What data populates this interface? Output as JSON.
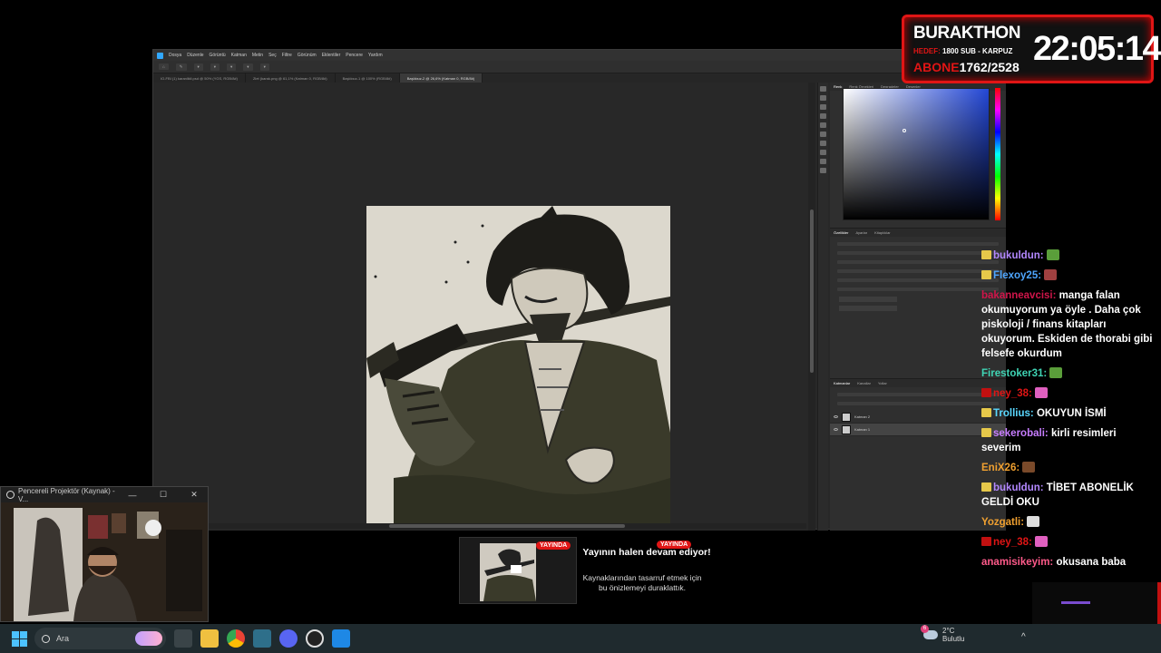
{
  "photoshop": {
    "menu": [
      "Dosya",
      "Düzenle",
      "Görüntü",
      "Katman",
      "Metin",
      "Seç",
      "Filtre",
      "Görünüm",
      "Eklentiler",
      "Pencere",
      "Yardım"
    ],
    "tabs": [
      "IO-FBI (1) karanlikli.psd @ 50% (YGS, RGB/8#)",
      "Ziet (karak.png @ 61,1% (Katman 0, RGB/8#)",
      "Başlıksız-1 @ 100% (RGB/8#)",
      "Başlıksız-2 @ 26,6% (Katman 0, RGB/8#)"
    ],
    "panel_tabs_top": [
      "Renk",
      "Renk Örnekleri",
      "Degradeler",
      "Desenler"
    ],
    "panel_tabs_mid": [
      "Özellikler",
      "Ayarlar",
      "Kitaplıklar"
    ],
    "panel_tabs_layers": [
      "Katmanlar",
      "Kanallar",
      "Yollar"
    ],
    "layers": [
      "Katman 2",
      "Katman 1"
    ]
  },
  "timer": {
    "brand": "BURAKTHON",
    "hedef_label": "HEDEF:",
    "hedef_value": "1800 SUB - KARPUZ",
    "abone_label": "ABONE",
    "abone_value": "1762/2528",
    "time": "22:05:14"
  },
  "chat": [
    {
      "user": "bukuldun:",
      "color": "#b388ff",
      "text": "",
      "badge": "#e6c84a",
      "emote": "#5a9e3a"
    },
    {
      "user": "Flexoy25:",
      "color": "#4ea6ff",
      "text": "",
      "badge": "#e6c84a",
      "emote": "#a04040"
    },
    {
      "user": "bakanneavcisi:",
      "color": "#d0154a",
      "text": "manga falan okumuyorum ya öyle . Daha çok piskoloji / finans kitapları okuyorum. Eskiden de thorabi gibi felsefe okurdum",
      "badge": "",
      "emote": ""
    },
    {
      "user": "Firestoker31:",
      "color": "#3fd4b4",
      "text": "",
      "badge": "",
      "emote": "#5a9e3a"
    },
    {
      "user": "ney_38:",
      "color": "#e01515",
      "text": "",
      "badge": "#c21010",
      "emote": "#e060c0"
    },
    {
      "user": "Trollius:",
      "color": "#5ad8ff",
      "text": "OKUYUN İSMİ",
      "badge": "#e6c84a",
      "emote": ""
    },
    {
      "user": "sekerobali:",
      "color": "#c77dff",
      "text": "kirli resimleri severim",
      "badge": "#e6c84a",
      "emote": ""
    },
    {
      "user": "EniX26:",
      "color": "#f0a030",
      "text": "",
      "badge": "",
      "emote": "#7a4a2a"
    },
    {
      "user": "bukuldun:",
      "color": "#b388ff",
      "text": "TİBET ABONELİK GELDİ OKU",
      "badge": "#e6c84a",
      "emote": ""
    },
    {
      "user": "Yozgatli:",
      "color": "#f0a030",
      "text": "",
      "badge": "",
      "emote": "#dddddd"
    },
    {
      "user": "ney_38:",
      "color": "#e01515",
      "text": "",
      "badge": "#c21010",
      "emote": "#e060c0"
    },
    {
      "user": "anamisikeyim:",
      "color": "#ff5a8a",
      "text": "okusana baba",
      "badge": "",
      "emote": ""
    }
  ],
  "projector": {
    "title": "Pencereli Projektör (Kaynak) - V...",
    "minimize": "—",
    "maximize": "☐",
    "close": "✕"
  },
  "notice": {
    "live_badge": "YAYINDA",
    "title": "Yayının halen devam ediyor!",
    "subtitle": "Kaynaklarından tasarruf etmek için bu önizlemeyi duraklattık."
  },
  "taskbar": {
    "search_placeholder": "Ara",
    "weather_temp": "2°C",
    "weather_desc": "Bulutlu",
    "weather_badge": "6",
    "tray_arrow": "^"
  }
}
